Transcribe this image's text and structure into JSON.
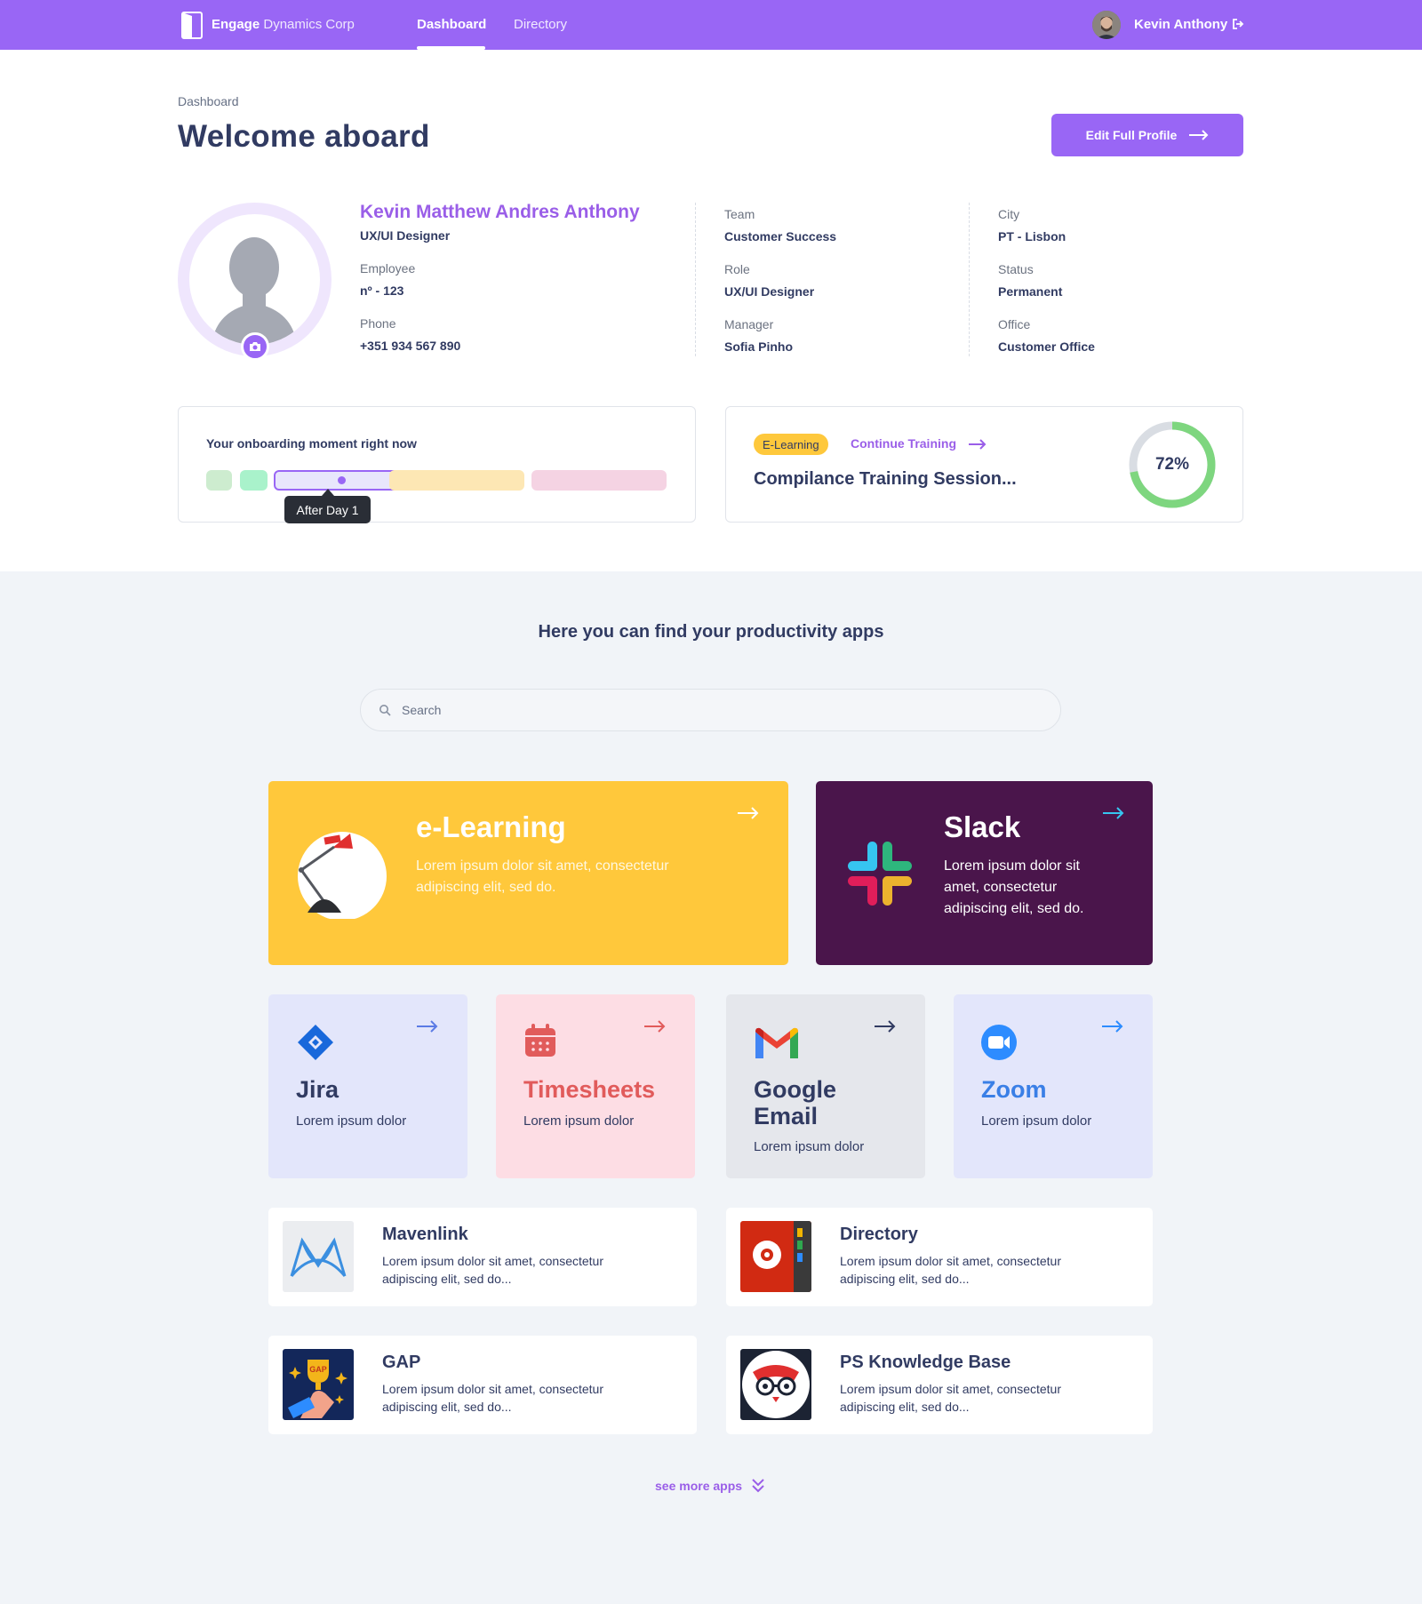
{
  "nav": {
    "brand_bold": "Engage",
    "brand_rest": "Dynamics Corp",
    "links": [
      "Dashboard",
      "Directory"
    ],
    "active": "Dashboard",
    "user_name": "Kevin Anthony"
  },
  "header": {
    "breadcrumb": "Dashboard",
    "title": "Welcome aboard",
    "edit_button": "Edit Full Profile"
  },
  "profile": {
    "full_name": "Kevin Matthew Andres Anthony",
    "job_title": "UX/UI Designer",
    "employee_label": "Employee",
    "employee_value": "nº - 123",
    "phone_label": "Phone",
    "phone_value": "+351 934 567 890",
    "team_label": "Team",
    "team_value": "Customer Success",
    "role_label": "Role",
    "role_value": "UX/UI Designer",
    "manager_label": "Manager",
    "manager_value": "Sofia Pinho",
    "city_label": "City",
    "city_value": "PT - Lisbon",
    "status_label": "Status",
    "status_value": "Permanent",
    "office_label": "Office",
    "office_value": "Customer Office"
  },
  "onboarding": {
    "title": "Your onboarding moment right now",
    "tooltip": "After Day 1",
    "stage_colors": [
      "#cdeccf",
      "#a9f2cb",
      "#e8e6fc",
      "#fde7b4",
      "#f5d3e3"
    ],
    "current_stage_index": 2
  },
  "training": {
    "badge": "E-Learning",
    "continue_label": "Continue Training",
    "course_title": "Compilance Training Session...",
    "progress_percent": 72,
    "progress_label": "72%",
    "progress_color": "#7ed67f"
  },
  "apps": {
    "heading": "Here you can find your productivity apps",
    "search_placeholder": "Search",
    "featured": [
      {
        "name": "e-Learning",
        "desc": "Lorem ipsum dolor sit amet, consectetur adipiscing elit, sed do.",
        "bg": "#ffc83b"
      },
      {
        "name": "Slack",
        "desc": "Lorem ipsum dolor sit amet, consectetur adipiscing elit, sed do.",
        "bg": "#4a154b"
      }
    ],
    "tiles": [
      {
        "name": "Jira",
        "desc": "Lorem ipsum dolor",
        "bg": "#e3e6fb",
        "color": "#313b62"
      },
      {
        "name": "Timesheets",
        "desc": "Lorem ipsum dolor",
        "bg": "#fddde4",
        "color": "#e15b5b"
      },
      {
        "name": "Google Email",
        "desc": "Lorem ipsum dolor",
        "bg": "#e5e7ec",
        "color": "#313b62"
      },
      {
        "name": "Zoom",
        "desc": "Lorem ipsum dolor",
        "bg": "#e3e6fb",
        "color": "#3a7fe6"
      }
    ],
    "list": [
      {
        "name": "Mavenlink",
        "desc": "Lorem ipsum dolor sit amet, consectetur adipiscing elit, sed do..."
      },
      {
        "name": "Directory",
        "desc": "Lorem ipsum dolor sit amet, consectetur adipiscing elit, sed do..."
      },
      {
        "name": "GAP",
        "desc": "Lorem ipsum dolor sit amet, consectetur adipiscing elit, sed do..."
      },
      {
        "name": "PS Knowledge Base",
        "desc": "Lorem ipsum dolor sit amet, consectetur adipiscing elit, sed do..."
      }
    ],
    "see_more": "see more apps"
  }
}
